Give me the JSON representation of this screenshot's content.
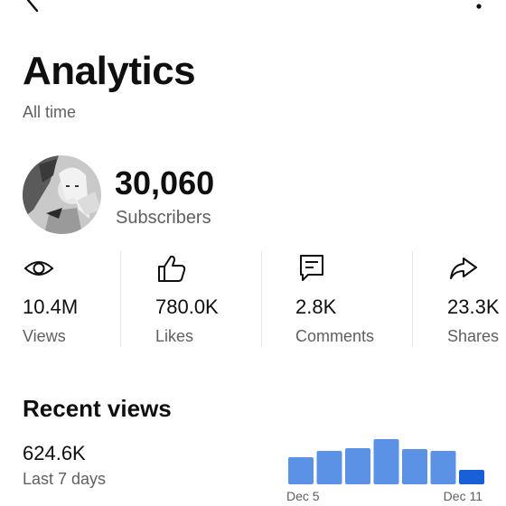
{
  "header": {
    "back_icon": "back-arrow-icon",
    "more_icon": "more-vertical-icon",
    "title": "Analytics",
    "subtitle": "All time"
  },
  "channel": {
    "subscribers_value": "30,060",
    "subscribers_label": "Subscribers"
  },
  "stats": [
    {
      "icon": "eye-icon",
      "value": "10.4M",
      "label": "Views"
    },
    {
      "icon": "thumbs-up-icon",
      "value": "780.0K",
      "label": "Likes"
    },
    {
      "icon": "comment-icon",
      "value": "2.8K",
      "label": "Comments"
    },
    {
      "icon": "share-icon",
      "value": "23.3K",
      "label": "Shares"
    }
  ],
  "recent_views": {
    "title": "Recent views",
    "value": "624.6K",
    "label": "Last 7 days"
  },
  "colors": {
    "bar": "#5b92e5",
    "bar_latest": "#1a5fd6",
    "secondary_text": "#606060"
  },
  "chart_data": {
    "type": "bar",
    "title": "",
    "xlabel": "",
    "ylabel": "",
    "categories": [
      "Dec 5",
      "Dec 6",
      "Dec 7",
      "Dec 8",
      "Dec 9",
      "Dec 10",
      "Dec 11"
    ],
    "visible_tick_labels": [
      "Dec 5",
      "Dec 11"
    ],
    "values": [
      30,
      37,
      40,
      50,
      39,
      37,
      16
    ],
    "ylim": [
      0,
      52
    ],
    "grid": false,
    "legend": "none"
  }
}
